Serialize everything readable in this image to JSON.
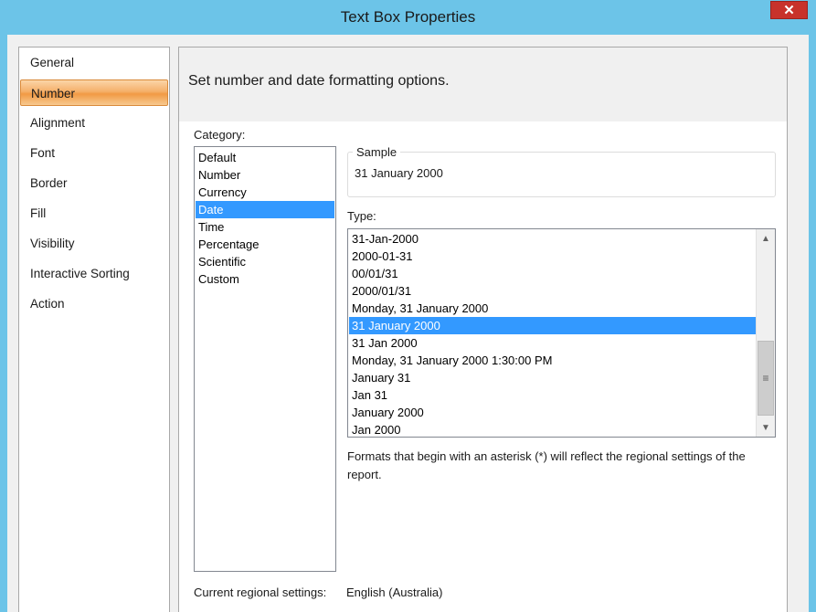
{
  "window": {
    "title": "Text Box Properties",
    "close_glyph": "✕"
  },
  "nav": {
    "items": [
      {
        "label": "General"
      },
      {
        "label": "Number"
      },
      {
        "label": "Alignment"
      },
      {
        "label": "Font"
      },
      {
        "label": "Border"
      },
      {
        "label": "Fill"
      },
      {
        "label": "Visibility"
      },
      {
        "label": "Interactive Sorting"
      },
      {
        "label": "Action"
      }
    ],
    "selected": "Number"
  },
  "page": {
    "heading": "Set number and date formatting options.",
    "category_label": "Category:",
    "categories": [
      "Default",
      "Number",
      "Currency",
      "Date",
      "Time",
      "Percentage",
      "Scientific",
      "Custom"
    ],
    "selected_category": "Date",
    "sample_label": "Sample",
    "sample_value": "31 January 2000",
    "type_label": "Type:",
    "types": [
      "31-Jan-2000",
      "2000-01-31",
      "00/01/31",
      "2000/01/31",
      "Monday, 31 January 2000",
      "31 January 2000",
      "31 Jan 2000",
      "Monday, 31 January 2000 1:30:00 PM",
      "January 31",
      "Jan 31",
      "January 2000",
      "Jan 2000"
    ],
    "selected_type": "31 January 2000",
    "note": "Formats that begin with an asterisk (*) will reflect the regional settings of the report.",
    "regional_label": "Current regional settings:",
    "regional_value": "English (Australia)"
  },
  "scrollbar": {
    "up_glyph": "▲",
    "down_glyph": "▼",
    "grip_glyph": "≡"
  },
  "colors": {
    "titlebar": "#6cc4e8",
    "close": "#c8322b",
    "selection": "#3399ff",
    "nav_selected": "#f5b06a"
  }
}
